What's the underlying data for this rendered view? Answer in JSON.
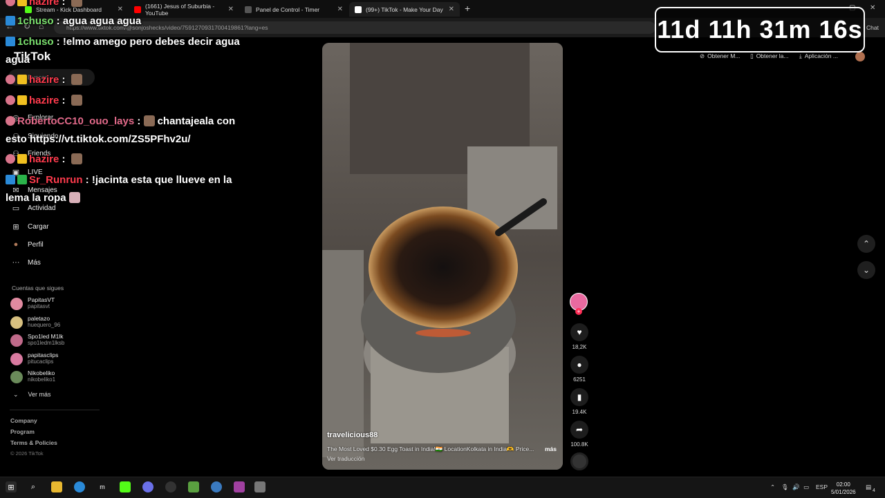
{
  "browser": {
    "tabs": [
      {
        "title": "Stream - Kick Dashboard",
        "color": "#53fc18"
      },
      {
        "title": "(1661) Jesus of Suburbia - YouTube",
        "color": "#ff0000"
      },
      {
        "title": "Panel de Control - Timer",
        "color": "#555555"
      },
      {
        "title": "(99+) TikTok - Make Your Day",
        "color": "#ffffff"
      }
    ],
    "url": "https://www.tiktok.com/@sonjoshecks/video/7591270931700419861?lang=es",
    "chat_label": "Chat"
  },
  "timer": {
    "text": "11d 11h 31m 16s"
  },
  "chat": [
    {
      "user": "hazire",
      "sep": " : ",
      "text": "",
      "color": "red",
      "badges": [
        "pink",
        "crown"
      ]
    },
    {
      "user": "1chuso",
      "sep": " : ",
      "text": "agua agua agua",
      "color": "green",
      "badges": [
        "blue"
      ]
    },
    {
      "user": "1chuso",
      "sep": " : ",
      "text": "!elmo amego pero debes decir agua agua",
      "color": "green",
      "badges": [
        "blue"
      ]
    },
    {
      "user": "hazire",
      "sep": " : ",
      "text": "",
      "color": "red",
      "badges": [
        "pink",
        "crown"
      ]
    },
    {
      "user": "hazire",
      "sep": " : ",
      "text": "",
      "color": "red",
      "badges": [
        "pink",
        "crown"
      ]
    },
    {
      "user": "RobertoCC10_ouo_lays",
      "sep": " : ",
      "text": "chantajeala con esto https://vt.tiktok.com/ZS5PFhv2u/",
      "color": "rose",
      "badges": [
        "pink"
      ]
    },
    {
      "user": "hazire",
      "sep": " : ",
      "text": "",
      "color": "red",
      "badges": [
        "pink",
        "crown"
      ]
    },
    {
      "user": "Sr_Runrun",
      "sep": " : ",
      "text": "!jacinta esta que llueve en la lema la ropa",
      "color": "red",
      "badges": [
        "blue",
        "mod"
      ]
    }
  ],
  "tiktok": {
    "logo": "TikTok",
    "search_placeholder": "Buscar",
    "nav": [
      {
        "label": "Explorar",
        "icon": "compass-icon",
        "glyph": "◎"
      },
      {
        "label": "Siguiendo",
        "icon": "following-icon",
        "glyph": "⚇"
      },
      {
        "label": "Friends",
        "icon": "friends-icon",
        "glyph": "⚇"
      },
      {
        "label": "LIVE",
        "icon": "live-icon",
        "glyph": "▣"
      },
      {
        "label": "Mensajes",
        "icon": "messages-icon",
        "glyph": "✉"
      },
      {
        "label": "Actividad",
        "icon": "activity-icon",
        "glyph": "▭"
      },
      {
        "label": "Cargar",
        "icon": "upload-icon",
        "glyph": "⊞"
      },
      {
        "label": "Perfil",
        "icon": "profile-icon",
        "glyph": "●"
      },
      {
        "label": "Más",
        "icon": "more-icon",
        "glyph": "···"
      }
    ],
    "following_title": "Cuentas que sigues",
    "following": [
      {
        "name": "PapitasVT",
        "handle": "papitasvt",
        "color": "#e08aa0"
      },
      {
        "name": "paletazo",
        "handle": "huequero_96",
        "color": "#d8c080"
      },
      {
        "name": "Spo1led M1lk",
        "handle": "spo1ledm1lksb",
        "color": "#c06a8a"
      },
      {
        "name": "papitasclips",
        "handle": "pitucaclips",
        "color": "#d97aa0"
      },
      {
        "name": "Nikobeliko",
        "handle": "nikobeliko1",
        "color": "#6a8a5a"
      }
    ],
    "see_more": "Ver más",
    "footer": [
      "Company",
      "Program",
      "Terms & Policies",
      "© 2026 TikTok"
    ],
    "header_actions": [
      "Obtener M...",
      "Obtener la...",
      "Aplicación ..."
    ],
    "video": {
      "username": "travelicious88",
      "description": "The Most Loved $0.30 Egg Toast in India!🇮🇳 LocationKolkata in India🫶 Price...",
      "more": "más",
      "translate": "Ver traducción"
    },
    "actions": {
      "likes": "18,2K",
      "comments": "6251",
      "saves": "19.4K",
      "shares": "100.8K"
    }
  },
  "taskbar": {
    "lang": "ESP",
    "time": "02:00",
    "date": "5/01/2026",
    "notifications": "4"
  }
}
